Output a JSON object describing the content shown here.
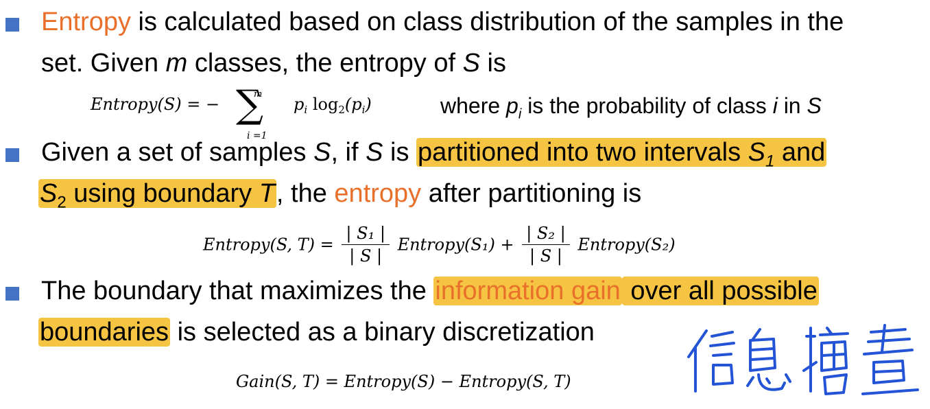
{
  "bullet1": {
    "line1_prefix": "Entropy",
    "line1_rest": " is calculated based on class distribution of the samples in the",
    "line2_a": "set.  Given ",
    "line2_m": "m",
    "line2_b": " classes, the entropy of ",
    "line2_S": "S",
    "line2_c": " is",
    "formula_lhs": "Entropy(S) = −",
    "sigma": "∑",
    "sum_upper": "m",
    "sum_lower": "i =1",
    "formula_rhs": "p",
    "where_a": "where ",
    "where_p": "p",
    "where_sub": "i",
    "where_b": " is the probability of class ",
    "where_i": "i",
    "where_c": " in ",
    "where_S": "S"
  },
  "bullet2": {
    "line1_a": "Given a set of samples ",
    "line1_S": "S",
    "line1_b": ", if ",
    "line1_S2": "S",
    "line1_c": " is ",
    "line1_hl": "partitioned into two intervals ",
    "line1_S1": "S",
    "line1_S1sub": "1",
    "line1_and": " and",
    "line2_S2": "S",
    "line2_S2sub": "2",
    "line2_hl": " using boundary ",
    "line2_T": "T",
    "line2_b": ", the ",
    "line2_entropy": "entropy",
    "line2_c": " after partitioning is",
    "formula_lhs": "Entropy(S, T) =",
    "frac1_num": "| S₁ |",
    "frac1_den": "| S |",
    "term1": "Entropy(S₁) +",
    "frac2_num": "| S₂ |",
    "frac2_den": "| S |",
    "term2": "Entropy(S₂)"
  },
  "bullet3": {
    "line1_a": "The boundary that maximizes the ",
    "line1_ig": "information gain",
    "line1_hl": " over all possible",
    "line2_hl": "boundaries",
    "line2_b": " is selected as a binary discretization",
    "formula": "Gain(S, T) = Entropy(S) − Entropy(S, T)"
  },
  "colors": {
    "bullet": "#4472c4",
    "accent_orange": "#e8702a",
    "highlight": "#f6c443",
    "handwriting": "#2454d6"
  }
}
